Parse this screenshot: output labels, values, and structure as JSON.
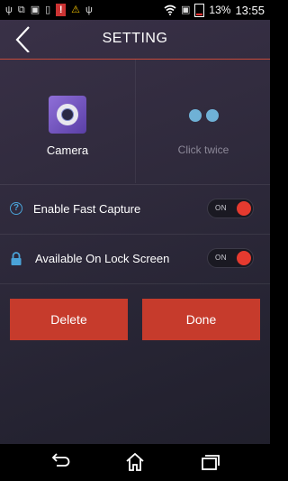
{
  "status_bar": {
    "battery_percent": "13%",
    "time": "13:55",
    "icons": [
      "usb-icon",
      "sync-icon",
      "image-icon",
      "sim-icon",
      "flag-icon",
      "warning-icon",
      "usb-icon",
      "wifi-icon",
      "no-sim-icon",
      "battery-icon"
    ]
  },
  "header": {
    "title": "SETTING",
    "back_icon": "chevron-left-icon",
    "accent_color": "#c74a3a"
  },
  "tiles": [
    {
      "label": "Camera",
      "icon": "camera-app-icon",
      "active": true
    },
    {
      "label": "Click twice",
      "icon": "double-dot-icon",
      "active": false
    }
  ],
  "settings": [
    {
      "label": "Enable Fast Capture",
      "icon": "help-icon",
      "toggle": "ON",
      "enabled": true
    },
    {
      "label": "Available On Lock Screen",
      "icon": "lock-icon",
      "toggle": "ON",
      "enabled": true
    }
  ],
  "buttons": {
    "delete": "Delete",
    "done": "Done",
    "color": "#c63b2c"
  },
  "navbar": {
    "icons": [
      "back-icon",
      "home-icon",
      "recent-apps-icon"
    ]
  }
}
